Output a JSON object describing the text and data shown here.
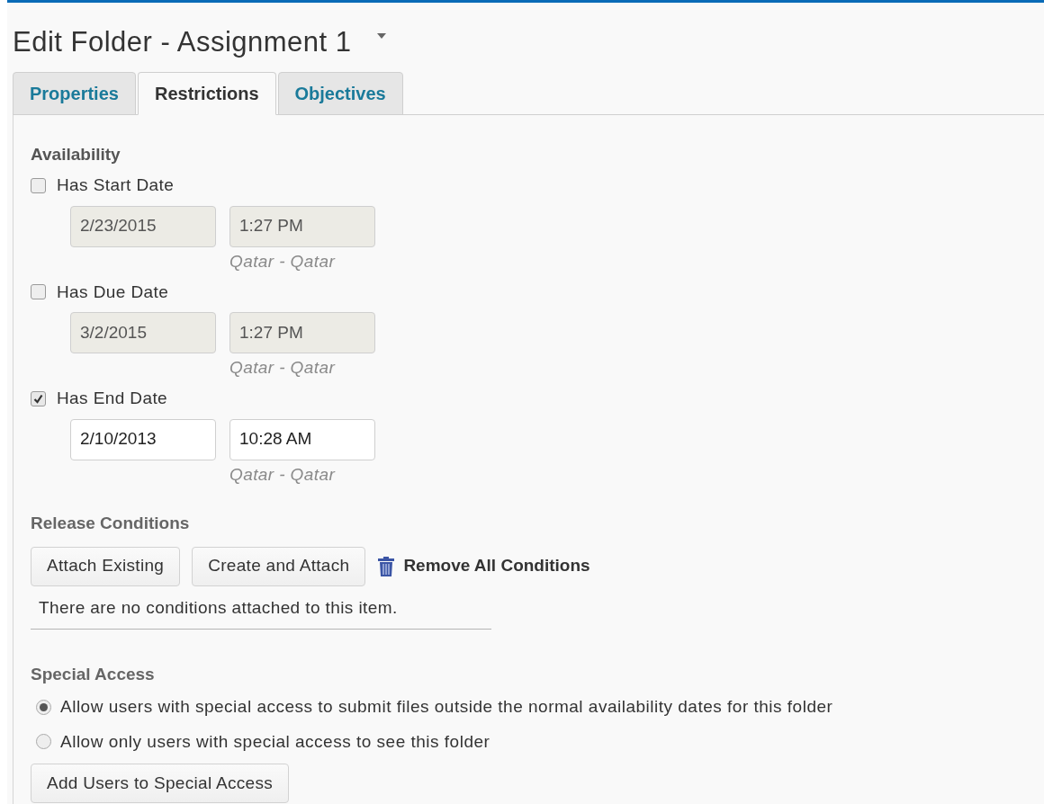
{
  "title": "Edit Folder - Assignment 1",
  "tabs": [
    {
      "label": "Properties",
      "selected": false
    },
    {
      "label": "Restrictions",
      "selected": true
    },
    {
      "label": "Objectives",
      "selected": false
    }
  ],
  "availability": {
    "heading": "Availability",
    "dates": [
      {
        "label": "Has Start Date",
        "checked": false,
        "date": "2/23/2015",
        "time": "1:27 PM",
        "timezone": "Qatar - Qatar"
      },
      {
        "label": "Has Due Date",
        "checked": false,
        "date": "3/2/2015",
        "time": "1:27 PM",
        "timezone": "Qatar - Qatar"
      },
      {
        "label": "Has End Date",
        "checked": true,
        "date": "2/10/2013",
        "time": "10:28 AM",
        "timezone": "Qatar - Qatar"
      }
    ]
  },
  "release_conditions": {
    "heading": "Release Conditions",
    "buttons": [
      "Attach Existing",
      "Create and Attach"
    ],
    "remove_link": "Remove All Conditions",
    "empty_message": "There are no conditions attached to this item."
  },
  "special_access": {
    "heading": "Special Access",
    "options": [
      {
        "label": "Allow users with special access to submit files outside the normal availability dates for this folder",
        "selected": true
      },
      {
        "label": "Allow only users with special access to see this folder",
        "selected": false
      }
    ],
    "button": "Add Users to Special Access"
  }
}
